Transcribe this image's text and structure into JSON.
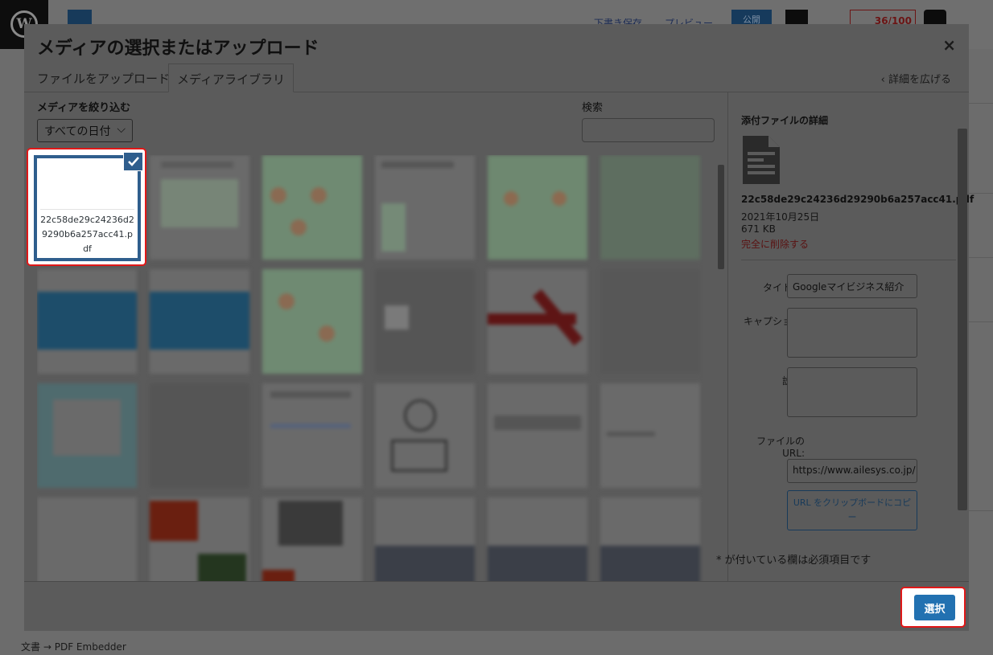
{
  "background": {
    "save_draft": "下書き保存",
    "preview": "プレビュー",
    "publish": "公開",
    "score": "36/100",
    "breadcrumb": [
      "文書",
      "→",
      "PDF Embedder"
    ]
  },
  "modal": {
    "title": "メディアの選択またはアップロード",
    "close_label": "×",
    "tabs": [
      {
        "label": "ファイルをアップロード",
        "active": false
      },
      {
        "label": "メディアライブラリ",
        "active": true
      }
    ],
    "expand_details": "‹ 詳細を広げる"
  },
  "filters": {
    "label": "メディアを絞り込む",
    "date_value": "すべての日付",
    "search_label": "検索",
    "search_value": ""
  },
  "selected_item": {
    "filename": "22c58de29c24236d29290b6a257acc41.pdf"
  },
  "details": {
    "heading": "添付ファイルの詳細",
    "filename": "22c58de29c24236d29290b6a257acc41.pdf",
    "date": "2021年10月25日",
    "size": "671 KB",
    "delete_label": "完全に削除する",
    "title_label": "タイトル",
    "title_value": "Googleマイビジネス紹介",
    "caption_label": "キャプション",
    "caption_value": "",
    "description_label": "説明",
    "description_value": "",
    "url_label_1": "ファイルの",
    "url_label_2": "URL:",
    "url_value": "https://www.ailesys.co.jp/",
    "copy_label": "URL をクリップボードにコピー",
    "required_note": "* が付いている欄は必須項目です"
  },
  "footer": {
    "select_label": "選択"
  },
  "colors": {
    "accent": "#2271b1",
    "highlight": "#e01818",
    "selected_border": "#2f5e8d"
  }
}
